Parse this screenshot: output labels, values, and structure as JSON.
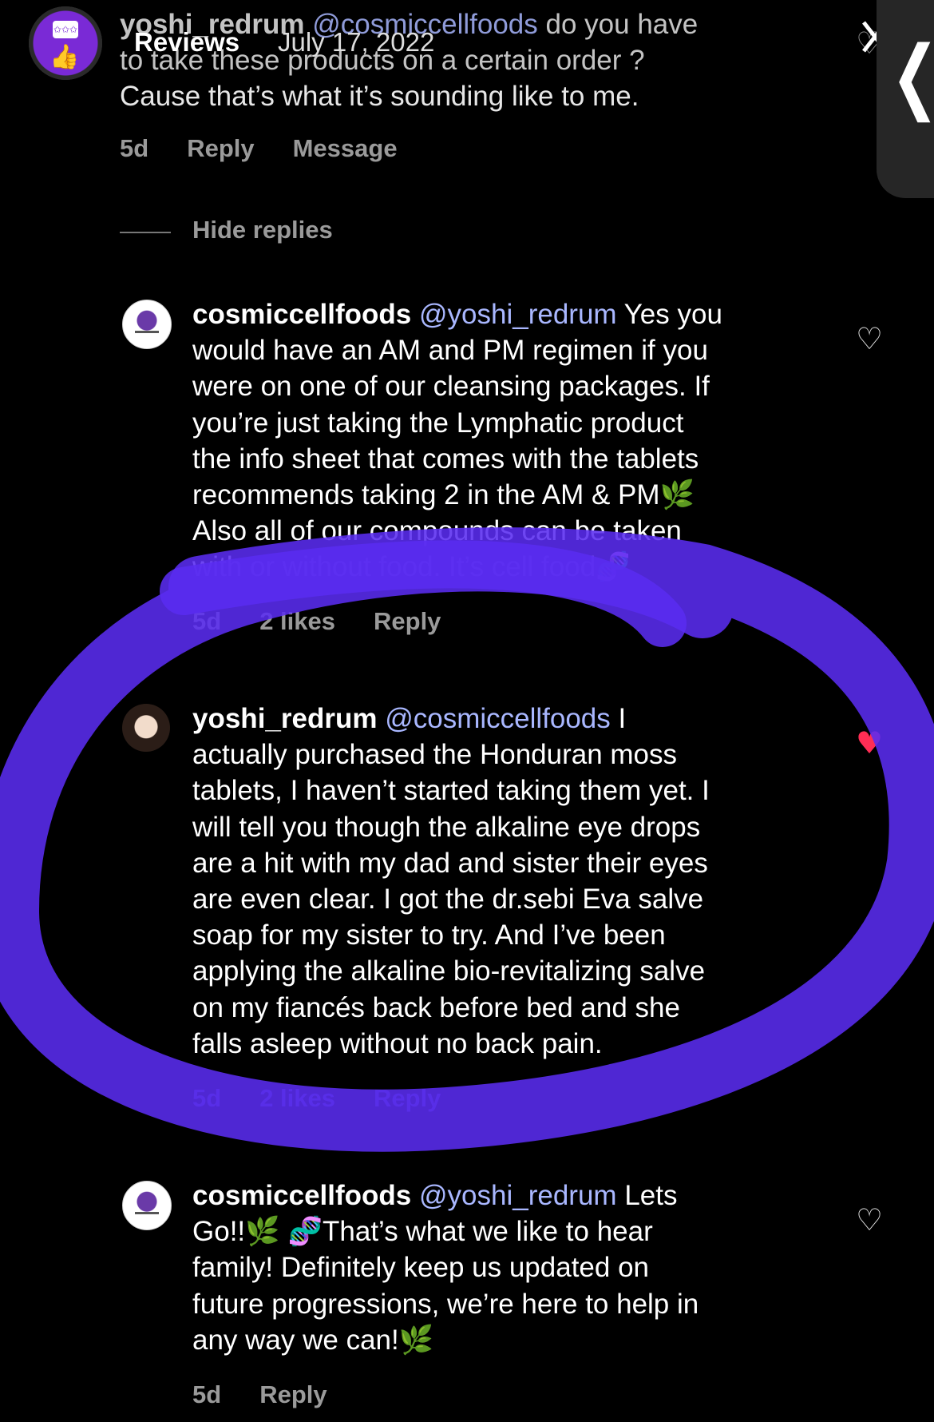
{
  "highlight": {
    "title": "Reviews",
    "date": "July 17, 2022",
    "close_glyph": "✕"
  },
  "side_tab_glyph": "❮",
  "thread": {
    "parent": {
      "username": "yoshi_redrum",
      "mention": "@cosmiccellfoods",
      "line1_rest": "do you have",
      "line2": "to take these products on a certain order ?",
      "line3": "Cause that’s what it’s sounding like to me.",
      "time": "5d",
      "reply": "Reply",
      "message": "Message"
    },
    "hide_replies": "Hide replies",
    "replies": [
      {
        "username": "cosmiccellfoods",
        "mention": "@yoshi_redrum",
        "lines": [
          "Yes you",
          "would have an AM and PM regimen if you",
          "were on one of our cleansing packages. If",
          "you’re just taking the Lymphatic product",
          "the info sheet that comes with the tablets",
          "recommends taking 2 in the AM & PM🌿",
          "Also all of our compounds can be taken",
          "with or without food. It’s cell food🧬"
        ],
        "time": "5d",
        "likes": "2 likes",
        "reply": "Reply",
        "liked": false
      },
      {
        "username": "yoshi_redrum",
        "mention": "@cosmiccellfoods",
        "lines": [
          "I",
          "actually purchased the Honduran moss",
          "tablets, I haven’t started taking them yet. I",
          "will tell you though the alkaline eye drops",
          "are a hit with my dad and sister their eyes",
          "are even clear. I got the dr.sebi Eva salve",
          "soap for my sister to try. And I’ve been",
          "applying the alkaline bio-revitalizing salve",
          "on my fiancés back before bed and she",
          "falls asleep without no back pain."
        ],
        "time": "5d",
        "likes": "2 likes",
        "reply": "Reply",
        "liked": true
      },
      {
        "username": "cosmiccellfoods",
        "mention": "@yoshi_redrum",
        "lines": [
          "Lets",
          "Go!!🌿 🧬That’s what we like to hear",
          "family! Definitely keep us updated on",
          "future progressions, we’re here to help in",
          "any way we can!🌿"
        ],
        "time": "5d",
        "reply": "Reply",
        "liked": false
      }
    ]
  },
  "colors": {
    "background": "#000000",
    "highlight_stroke": "#5a2cf0",
    "liked_heart": "#ff2d55",
    "meta_text": "#9a9a9a"
  },
  "icons": {
    "badge": "reviews-thumbs-up-icon",
    "heart_empty": "heart-outline-icon",
    "heart_full": "heart-filled-icon"
  }
}
